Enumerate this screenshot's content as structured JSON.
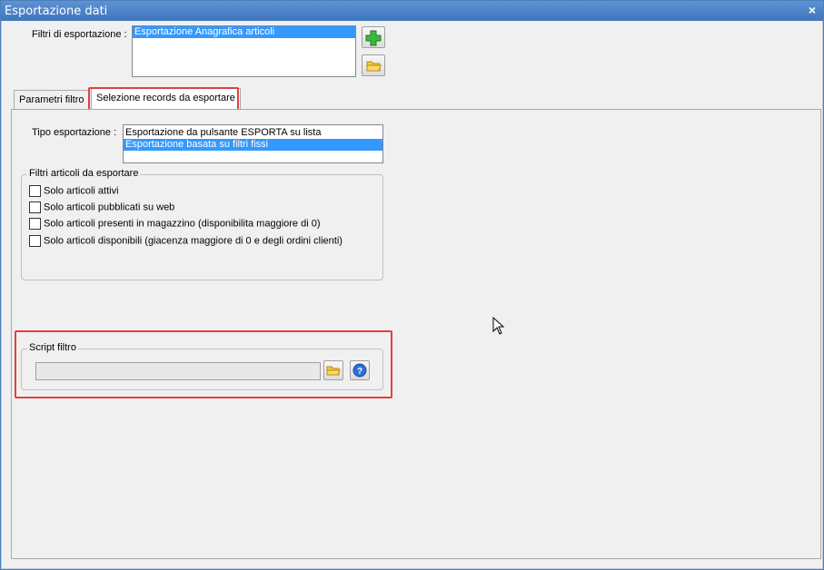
{
  "window": {
    "title": "Esportazione dati",
    "close_glyph": "×"
  },
  "filtri": {
    "label": "Filtri di esportazione :",
    "items": [
      "Esportazione Anagrafica articoli"
    ],
    "selected_index": 0,
    "add_button_icon": "plus-icon",
    "open_button_icon": "folder-icon"
  },
  "tabs": [
    {
      "label": "Parametri filtro",
      "active": false
    },
    {
      "label": "Selezione records da esportare",
      "active": true
    }
  ],
  "tipo": {
    "label": "Tipo esportazione :",
    "items": [
      "Esportazione da pulsante ESPORTA su lista",
      "Esportazione basata su filtri fissi"
    ],
    "selected_index": 1
  },
  "filtri_articoli": {
    "legend": "Filtri articoli da esportare",
    "options": [
      {
        "label": "Solo articoli attivi",
        "checked": false
      },
      {
        "label": "Solo articoli pubblicati su web",
        "checked": false
      },
      {
        "label": "Solo articoli presenti in magazzino (disponibilita maggiore di 0)",
        "checked": false
      },
      {
        "label": "Solo articoli disponibili (giacenza maggiore di 0 e degli ordini clienti)",
        "checked": false
      }
    ]
  },
  "script": {
    "legend": "Script filtro",
    "value": "",
    "open_button_icon": "folder-icon",
    "help_button_icon": "help-icon"
  },
  "colors": {
    "selection": "#3399ff",
    "highlight": "#e04040",
    "title_bar": "#4a7ebb"
  }
}
